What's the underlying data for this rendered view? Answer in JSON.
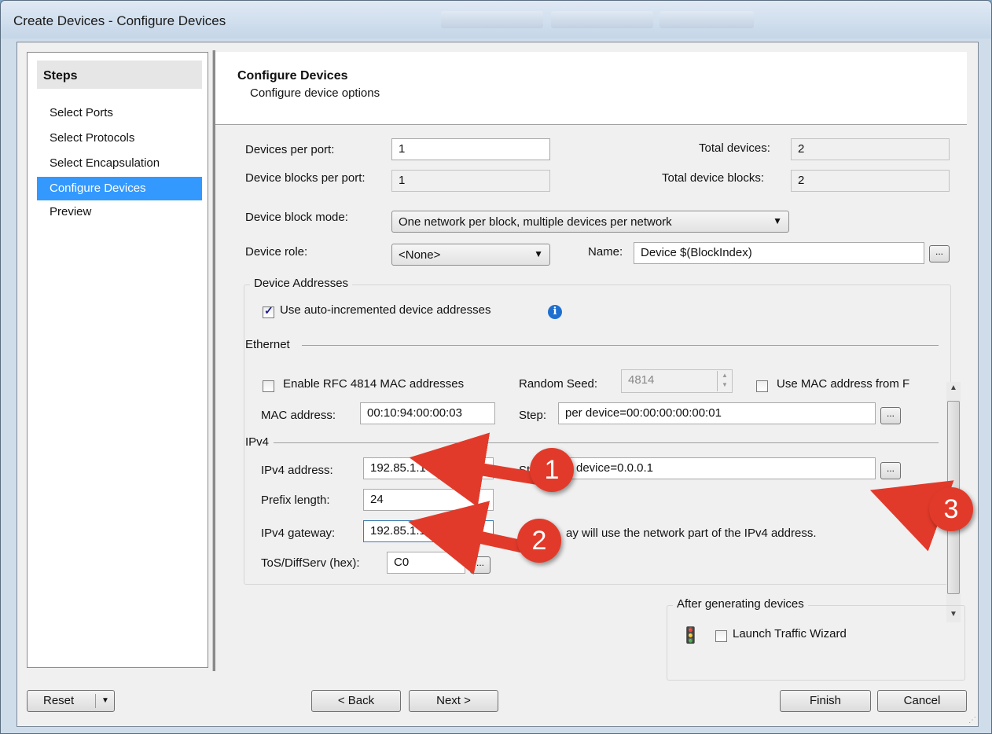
{
  "window": {
    "title": "Create Devices - Configure Devices"
  },
  "steps": {
    "heading": "Steps",
    "items": [
      {
        "label": "Select Ports",
        "selected": false
      },
      {
        "label": "Select Protocols",
        "selected": false
      },
      {
        "label": "Select Encapsulation",
        "selected": false
      },
      {
        "label": "Configure Devices",
        "selected": true
      },
      {
        "label": "Preview",
        "selected": false
      }
    ]
  },
  "header": {
    "title": "Configure Devices",
    "subtitle": "Configure device options"
  },
  "form": {
    "devices_per_port_label": "Devices per port:",
    "devices_per_port_value": "1",
    "total_devices_label": "Total devices:",
    "total_devices_value": "2",
    "device_blocks_label": "Device blocks per port:",
    "device_blocks_value": "1",
    "total_device_blocks_label": "Total device blocks:",
    "total_device_blocks_value": "2",
    "block_mode_label": "Device block mode:",
    "block_mode_value": "One network per block, multiple devices per network",
    "role_label": "Device role:",
    "role_value": "<None>",
    "name_label": "Name:",
    "name_value": "Device $(BlockIndex)",
    "browse_label": "..."
  },
  "addresses": {
    "legend": "Device Addresses",
    "auto_increment_label": "Use auto-incremented device addresses",
    "auto_increment_checked": true,
    "ethernet": {
      "legend": "Ethernet",
      "rfc_label": "Enable RFC 4814 MAC addresses",
      "rfc_checked": false,
      "random_seed_label": "Random Seed:",
      "random_seed_value": "4814",
      "use_mac_label": "Use MAC address from F",
      "use_mac_checked": false,
      "mac_label": "MAC address:",
      "mac_value": "00:10:94:00:00:03",
      "step_label": "Step:",
      "step_value": "per device=00:00:00:00:00:01"
    },
    "ipv4": {
      "legend": "IPv4",
      "address_label": "IPv4 address:",
      "address_value": "192.85.1.1",
      "step_label_visible": "Ste",
      "step_value_visible": "device=0.0.0.1",
      "prefix_label": "Prefix length:",
      "prefix_value": "24",
      "gateway_label": "IPv4 gateway:",
      "gateway_value": "192.85.1.1",
      "gateway_note_visible": "ay will use the network part of the IPv4 address.",
      "tos_label": "ToS/DiffServ (hex):",
      "tos_value": "C0"
    }
  },
  "after": {
    "legend": "After generating devices",
    "launch_label": "Launch Traffic Wizard",
    "launch_checked": false
  },
  "buttons": {
    "reset": "Reset",
    "back": "< Back",
    "next": "Next >",
    "finish": "Finish",
    "cancel": "Cancel"
  },
  "annotations": [
    "1",
    "2",
    "3"
  ],
  "colors": {
    "selection": "#3399ff",
    "annotation": "#e23a2a",
    "info": "#1f6fd0"
  }
}
